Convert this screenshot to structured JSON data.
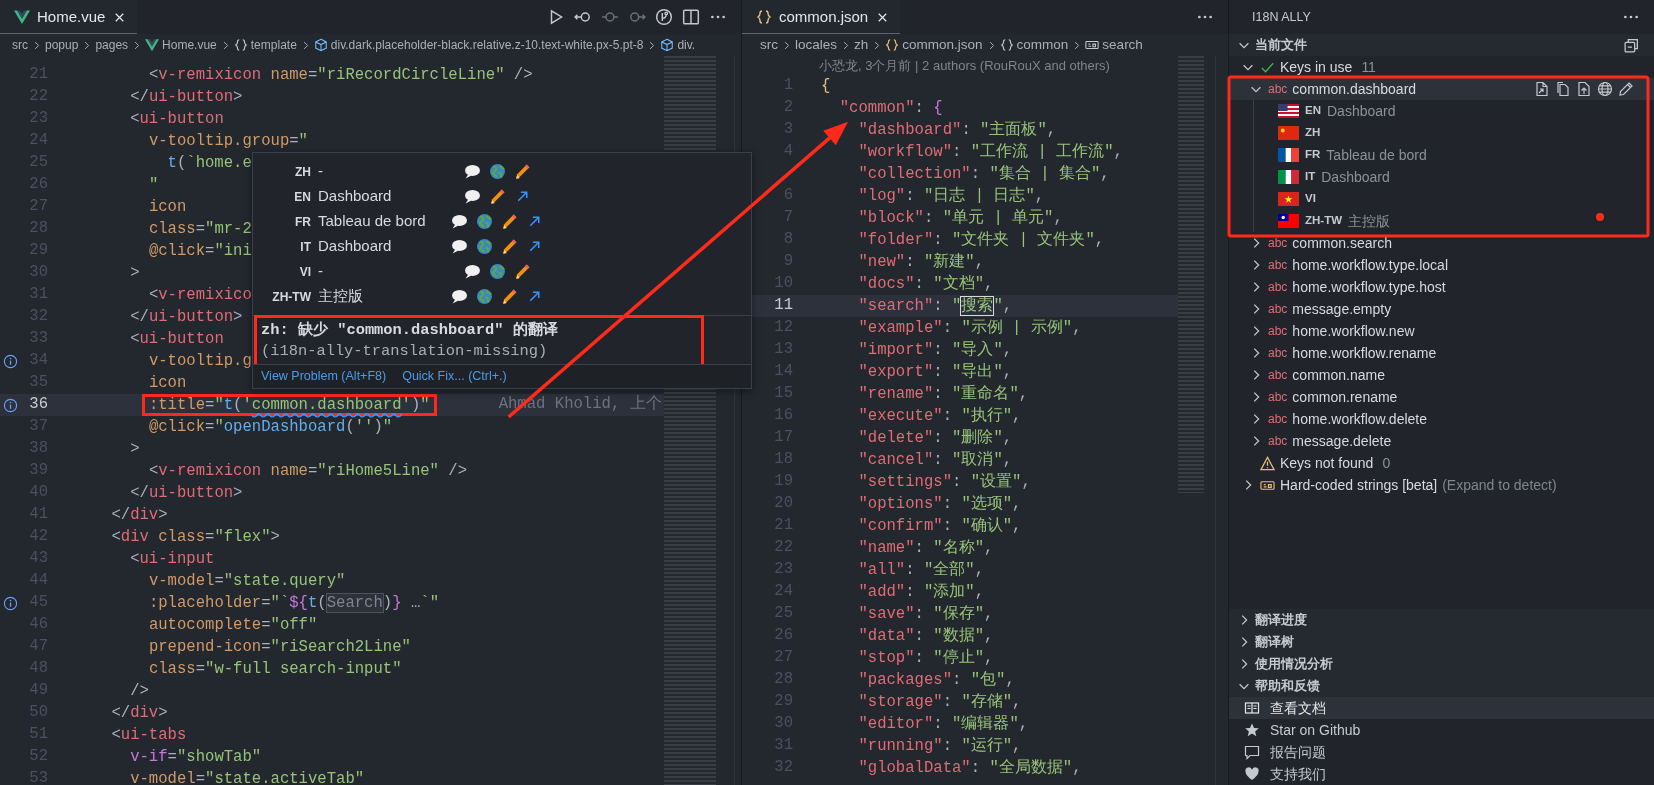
{
  "editors": [
    {
      "tabs": [
        {
          "label": "Home.vue",
          "kind": "vue",
          "selected": true
        }
      ],
      "toolbar": [
        {
          "kind": "play"
        },
        {
          "kind": "back-circle"
        },
        {
          "kind": "commit"
        },
        {
          "kind": "forward-circle"
        },
        {
          "kind": "branch-circle"
        },
        {
          "kind": "split"
        },
        {
          "kind": "more"
        }
      ],
      "breadcrumb": [
        {
          "label": "src"
        },
        {
          "label": "popup"
        },
        {
          "label": "pages"
        },
        {
          "label": "Home.vue",
          "kind": "vue"
        },
        {
          "label": "template",
          "kind": "braces"
        },
        {
          "label": "div.dark.placeholder-black.relative.z-10.text-white.px-5.pt-8",
          "kind": "cube"
        },
        {
          "label": "div.",
          "kind": "cube"
        }
      ],
      "lines": [
        {
          "n": "21",
          "current": false,
          "info": false,
          "tokens": [
            {
              "kind": "p",
              "text": "        <"
            },
            {
              "kind": "t",
              "text": "v-remixicon"
            },
            {
              "kind": "a",
              "text": " name"
            },
            {
              "kind": "p",
              "text": "="
            },
            {
              "kind": "s",
              "text": "\"riRecordCircleLine\""
            },
            {
              "kind": "p",
              "text": " />"
            }
          ]
        },
        {
          "n": "22",
          "current": false,
          "info": false,
          "tokens": [
            {
              "kind": "p",
              "text": "      </"
            },
            {
              "kind": "t",
              "text": "ui-button"
            },
            {
              "kind": "p",
              "text": ">"
            }
          ]
        },
        {
          "n": "23",
          "current": false,
          "info": false,
          "tokens": [
            {
              "kind": "p",
              "text": "      <"
            },
            {
              "kind": "t",
              "text": "ui-button"
            }
          ]
        },
        {
          "n": "24",
          "current": false,
          "info": false,
          "tokens": [
            {
              "kind": "a",
              "text": "        v-tooltip.group"
            },
            {
              "kind": "p",
              "text": "="
            },
            {
              "kind": "s",
              "text": "\""
            }
          ]
        },
        {
          "n": "25",
          "current": false,
          "info": false,
          "tokens": [
            {
              "kind": "f",
              "text": "          t"
            },
            {
              "kind": "p",
              "text": "("
            },
            {
              "kind": "s",
              "text": "`home.e"
            }
          ]
        },
        {
          "n": "26",
          "current": false,
          "info": false,
          "tokens": [
            {
              "kind": "s",
              "text": "        \""
            }
          ]
        },
        {
          "n": "27",
          "current": false,
          "info": false,
          "tokens": [
            {
              "kind": "a",
              "text": "        icon"
            }
          ]
        },
        {
          "n": "28",
          "current": false,
          "info": false,
          "tokens": [
            {
              "kind": "a",
              "text": "        class"
            },
            {
              "kind": "p",
              "text": "="
            },
            {
              "kind": "s",
              "text": "\"mr-2"
            }
          ]
        },
        {
          "n": "29",
          "current": false,
          "info": false,
          "tokens": [
            {
              "kind": "a",
              "text": "        @click"
            },
            {
              "kind": "p",
              "text": "="
            },
            {
              "kind": "s",
              "text": "\"ini"
            }
          ]
        },
        {
          "n": "30",
          "current": false,
          "info": false,
          "tokens": [
            {
              "kind": "p",
              "text": "      >"
            }
          ]
        },
        {
          "n": "31",
          "current": false,
          "info": false,
          "tokens": [
            {
              "kind": "p",
              "text": "        <"
            },
            {
              "kind": "t",
              "text": "v-remixico"
            }
          ]
        },
        {
          "n": "32",
          "current": false,
          "info": false,
          "tokens": [
            {
              "kind": "p",
              "text": "      </"
            },
            {
              "kind": "t",
              "text": "ui-button"
            },
            {
              "kind": "p",
              "text": ">"
            }
          ]
        },
        {
          "n": "33",
          "current": false,
          "info": false,
          "tokens": [
            {
              "kind": "p",
              "text": "      <"
            },
            {
              "kind": "t",
              "text": "ui-button"
            }
          ]
        },
        {
          "n": "34",
          "current": false,
          "info": true,
          "tokens": [
            {
              "kind": "a",
              "text": "        v-tooltip.g"
            }
          ]
        },
        {
          "n": "35",
          "current": false,
          "info": false,
          "tokens": [
            {
              "kind": "a",
              "text": "        icon"
            }
          ]
        },
        {
          "n": "36",
          "current": true,
          "info": true,
          "blame": "Ahmad Kholid, 上个",
          "tokens": [
            {
              "kind": "a",
              "text": "        :title"
            },
            {
              "kind": "p",
              "text": "="
            },
            {
              "kind": "s",
              "text": "\""
            },
            {
              "kind": "f",
              "text": "t"
            },
            {
              "kind": "p",
              "text": "("
            },
            {
              "kind": "s",
              "text": "'"
            },
            {
              "kind": "w",
              "text": "common.dashboard"
            },
            {
              "kind": "s",
              "text": "'"
            },
            {
              "kind": "p",
              "text": ")"
            },
            {
              "kind": "s",
              "text": "\""
            }
          ]
        },
        {
          "n": "37",
          "current": false,
          "info": false,
          "tokens": [
            {
              "kind": "a",
              "text": "        @click"
            },
            {
              "kind": "p",
              "text": "="
            },
            {
              "kind": "s",
              "text": "\""
            },
            {
              "kind": "f",
              "text": "openDashboard"
            },
            {
              "kind": "p",
              "text": "("
            },
            {
              "kind": "s",
              "text": "''"
            },
            {
              "kind": "p",
              "text": ")"
            },
            {
              "kind": "s",
              "text": "\""
            }
          ]
        },
        {
          "n": "38",
          "current": false,
          "info": false,
          "tokens": [
            {
              "kind": "p",
              "text": "      >"
            }
          ]
        },
        {
          "n": "39",
          "current": false,
          "info": false,
          "tokens": [
            {
              "kind": "p",
              "text": "        <"
            },
            {
              "kind": "t",
              "text": "v-remixicon"
            },
            {
              "kind": "a",
              "text": " name"
            },
            {
              "kind": "p",
              "text": "="
            },
            {
              "kind": "s",
              "text": "\"riHome5Line\""
            },
            {
              "kind": "p",
              "text": " />"
            }
          ]
        },
        {
          "n": "40",
          "current": false,
          "info": false,
          "tokens": [
            {
              "kind": "p",
              "text": "      </"
            },
            {
              "kind": "t",
              "text": "ui-button"
            },
            {
              "kind": "p",
              "text": ">"
            }
          ]
        },
        {
          "n": "41",
          "current": false,
          "info": false,
          "tokens": [
            {
              "kind": "p",
              "text": "    </"
            },
            {
              "kind": "t",
              "text": "div"
            },
            {
              "kind": "p",
              "text": ">"
            }
          ]
        },
        {
          "n": "42",
          "current": false,
          "info": false,
          "tokens": [
            {
              "kind": "p",
              "text": "    <"
            },
            {
              "kind": "t",
              "text": "div"
            },
            {
              "kind": "a",
              "text": " class"
            },
            {
              "kind": "p",
              "text": "="
            },
            {
              "kind": "s",
              "text": "\"flex\""
            },
            {
              "kind": "p",
              "text": ">"
            }
          ]
        },
        {
          "n": "43",
          "current": false,
          "info": false,
          "tokens": [
            {
              "kind": "p",
              "text": "      <"
            },
            {
              "kind": "t",
              "text": "ui-input"
            }
          ]
        },
        {
          "n": "44",
          "current": false,
          "info": false,
          "tokens": [
            {
              "kind": "a",
              "text": "        v-model"
            },
            {
              "kind": "p",
              "text": "="
            },
            {
              "kind": "s",
              "text": "\"state.query\""
            }
          ]
        },
        {
          "n": "45",
          "current": false,
          "info": true,
          "tokens": [
            {
              "kind": "a",
              "text": "        :placeholder"
            },
            {
              "kind": "p",
              "text": "="
            },
            {
              "kind": "s",
              "text": "\"`"
            },
            {
              "kind": "k",
              "text": "${"
            },
            {
              "kind": "f",
              "text": "t"
            },
            {
              "kind": "p",
              "text": "("
            },
            {
              "kind": "h",
              "text": "Search"
            },
            {
              "kind": "p",
              "text": ")"
            },
            {
              "kind": "k",
              "text": "}"
            },
            {
              "kind": "p",
              "text": " …"
            },
            {
              "kind": "s",
              "text": "`\""
            }
          ]
        },
        {
          "n": "46",
          "current": false,
          "info": false,
          "tokens": [
            {
              "kind": "a",
              "text": "        autocomplete"
            },
            {
              "kind": "p",
              "text": "="
            },
            {
              "kind": "s",
              "text": "\"off\""
            }
          ]
        },
        {
          "n": "47",
          "current": false,
          "info": false,
          "tokens": [
            {
              "kind": "a",
              "text": "        prepend-icon"
            },
            {
              "kind": "p",
              "text": "="
            },
            {
              "kind": "s",
              "text": "\"riSearch2Line\""
            }
          ]
        },
        {
          "n": "48",
          "current": false,
          "info": false,
          "tokens": [
            {
              "kind": "a",
              "text": "        class"
            },
            {
              "kind": "p",
              "text": "="
            },
            {
              "kind": "s",
              "text": "\"w-full search-input\""
            }
          ]
        },
        {
          "n": "49",
          "current": false,
          "info": false,
          "tokens": [
            {
              "kind": "p",
              "text": "      />"
            }
          ]
        },
        {
          "n": "50",
          "current": false,
          "info": false,
          "tokens": [
            {
              "kind": "p",
              "text": "    </"
            },
            {
              "kind": "t",
              "text": "div"
            },
            {
              "kind": "p",
              "text": ">"
            }
          ]
        },
        {
          "n": "51",
          "current": false,
          "info": false,
          "tokens": [
            {
              "kind": "p",
              "text": "    <"
            },
            {
              "kind": "t",
              "text": "ui-tabs"
            }
          ]
        },
        {
          "n": "52",
          "current": false,
          "info": false,
          "tokens": [
            {
              "kind": "k",
              "text": "      v-if"
            },
            {
              "kind": "p",
              "text": "="
            },
            {
              "kind": "s",
              "text": "\"showTab\""
            }
          ]
        },
        {
          "n": "53",
          "current": false,
          "info": false,
          "tokens": [
            {
              "kind": "a",
              "text": "      v-model"
            },
            {
              "kind": "p",
              "text": "="
            },
            {
              "kind": "s",
              "text": "\"state.activeTab\""
            }
          ]
        }
      ],
      "hover": {
        "rows": [
          {
            "code": "ZH",
            "value": "-",
            "actions": [
              {
                "kind": "comment"
              },
              {
                "kind": "globe"
              },
              {
                "kind": "edit"
              }
            ]
          },
          {
            "code": "EN",
            "value": "Dashboard",
            "actions": [
              {
                "kind": "comment"
              },
              {
                "kind": "edit"
              },
              {
                "kind": "open"
              }
            ]
          },
          {
            "code": "FR",
            "value": "Tableau de bord",
            "actions": [
              {
                "kind": "comment"
              },
              {
                "kind": "globe"
              },
              {
                "kind": "edit"
              },
              {
                "kind": "open"
              }
            ]
          },
          {
            "code": "IT",
            "value": "Dashboard",
            "actions": [
              {
                "kind": "comment"
              },
              {
                "kind": "globe"
              },
              {
                "kind": "edit"
              },
              {
                "kind": "open"
              }
            ]
          },
          {
            "code": "VI",
            "value": "-",
            "actions": [
              {
                "kind": "comment"
              },
              {
                "kind": "globe"
              },
              {
                "kind": "edit"
              }
            ]
          },
          {
            "code": "ZH-TW",
            "value": "主控版",
            "actions": [
              {
                "kind": "comment"
              },
              {
                "kind": "globe"
              },
              {
                "kind": "edit"
              },
              {
                "kind": "open"
              }
            ]
          }
        ],
        "message": "zh: 缺少 \"common.dashboard\" 的翻译",
        "source": "(i18n-ally-translation-missing)",
        "links": [
          "View Problem (Alt+F8)",
          "Quick Fix... (Ctrl+.)"
        ]
      }
    },
    {
      "tabs": [
        {
          "label": "common.json",
          "kind": "json",
          "selected": true
        }
      ],
      "toolbar": [
        {
          "kind": "more"
        }
      ],
      "breadcrumb": [
        {
          "label": "src"
        },
        {
          "label": "locales"
        },
        {
          "label": "zh"
        },
        {
          "label": "common.json",
          "kind": "json"
        },
        {
          "label": "common",
          "kind": "braces"
        },
        {
          "label": "search",
          "kind": "string-box"
        }
      ],
      "codelens": "小恐龙, 3个月前 | 2 authors (RouRouX and others)",
      "lines": [
        {
          "n": "1",
          "current": false,
          "tokens": [
            {
              "kind": "y",
              "text": "{"
            }
          ]
        },
        {
          "n": "2",
          "current": false,
          "tokens": [
            {
              "kind": "j",
              "text": "  \"common\""
            },
            {
              "kind": "p",
              "text": ": "
            },
            {
              "kind": "v",
              "text": "{"
            }
          ]
        },
        {
          "n": "3",
          "current": false,
          "tokens": [
            {
              "kind": "j",
              "text": "    \"dashboard\""
            },
            {
              "kind": "p",
              "text": ": "
            },
            {
              "kind": "s",
              "text": "\"主面板\""
            },
            {
              "kind": "p",
              "text": ","
            }
          ]
        },
        {
          "n": "4",
          "current": false,
          "tokens": [
            {
              "kind": "j",
              "text": "    \"workflow\""
            },
            {
              "kind": "p",
              "text": ": "
            },
            {
              "kind": "s",
              "text": "\"工作流 | 工作流\""
            },
            {
              "kind": "p",
              "text": ","
            }
          ]
        },
        {
          "current": false,
          "tokens": [
            {
              "kind": "j",
              "text": "    \"collection\""
            },
            {
              "kind": "p",
              "text": ": "
            },
            {
              "kind": "s",
              "text": "\"集合 | 集合\""
            },
            {
              "kind": "p",
              "text": ","
            }
          ]
        },
        {
          "n": "6",
          "current": false,
          "tokens": [
            {
              "kind": "j",
              "text": "    \"log\""
            },
            {
              "kind": "p",
              "text": ": "
            },
            {
              "kind": "s",
              "text": "\"日志 | 日志\""
            },
            {
              "kind": "p",
              "text": ","
            }
          ]
        },
        {
          "n": "7",
          "current": false,
          "tokens": [
            {
              "kind": "j",
              "text": "    \"block\""
            },
            {
              "kind": "p",
              "text": ": "
            },
            {
              "kind": "s",
              "text": "\"单元 | 单元\""
            },
            {
              "kind": "p",
              "text": ","
            }
          ]
        },
        {
          "n": "8",
          "current": false,
          "tokens": [
            {
              "kind": "j",
              "text": "    \"folder\""
            },
            {
              "kind": "p",
              "text": ": "
            },
            {
              "kind": "s",
              "text": "\"文件夹 | 文件夹\""
            },
            {
              "kind": "p",
              "text": ","
            }
          ]
        },
        {
          "n": "9",
          "current": false,
          "tokens": [
            {
              "kind": "j",
              "text": "    \"new\""
            },
            {
              "kind": "p",
              "text": ": "
            },
            {
              "kind": "s",
              "text": "\"新建\""
            },
            {
              "kind": "p",
              "text": ","
            }
          ]
        },
        {
          "n": "10",
          "current": false,
          "tokens": [
            {
              "kind": "j",
              "text": "    \"docs\""
            },
            {
              "kind": "p",
              "text": ": "
            },
            {
              "kind": "s",
              "text": "\"文档\""
            },
            {
              "kind": "p",
              "text": ","
            }
          ]
        },
        {
          "n": "11",
          "current": true,
          "tokens": [
            {
              "kind": "j",
              "text": "    \"search\""
            },
            {
              "kind": "p",
              "text": ": "
            },
            {
              "kind": "s",
              "text": "\""
            },
            {
              "kind": "x",
              "text": "搜索"
            },
            {
              "kind": "s",
              "text": "\""
            },
            {
              "kind": "p",
              "text": ","
            }
          ]
        },
        {
          "n": "12",
          "current": false,
          "tokens": [
            {
              "kind": "j",
              "text": "    \"example\""
            },
            {
              "kind": "p",
              "text": ": "
            },
            {
              "kind": "s",
              "text": "\"示例 | 示例\""
            },
            {
              "kind": "p",
              "text": ","
            }
          ]
        },
        {
          "n": "13",
          "current": false,
          "tokens": [
            {
              "kind": "j",
              "text": "    \"import\""
            },
            {
              "kind": "p",
              "text": ": "
            },
            {
              "kind": "s",
              "text": "\"导入\""
            },
            {
              "kind": "p",
              "text": ","
            }
          ]
        },
        {
          "n": "14",
          "current": false,
          "tokens": [
            {
              "kind": "j",
              "text": "    \"export\""
            },
            {
              "kind": "p",
              "text": ": "
            },
            {
              "kind": "s",
              "text": "\"导出\""
            },
            {
              "kind": "p",
              "text": ","
            }
          ]
        },
        {
          "n": "15",
          "current": false,
          "tokens": [
            {
              "kind": "j",
              "text": "    \"rename\""
            },
            {
              "kind": "p",
              "text": ": "
            },
            {
              "kind": "s",
              "text": "\"重命名\""
            },
            {
              "kind": "p",
              "text": ","
            }
          ]
        },
        {
          "n": "16",
          "current": false,
          "tokens": [
            {
              "kind": "j",
              "text": "    \"execute\""
            },
            {
              "kind": "p",
              "text": ": "
            },
            {
              "kind": "s",
              "text": "\"执行\""
            },
            {
              "kind": "p",
              "text": ","
            }
          ]
        },
        {
          "n": "17",
          "current": false,
          "tokens": [
            {
              "kind": "j",
              "text": "    \"delete\""
            },
            {
              "kind": "p",
              "text": ": "
            },
            {
              "kind": "s",
              "text": "\"删除\""
            },
            {
              "kind": "p",
              "text": ","
            }
          ]
        },
        {
          "n": "18",
          "current": false,
          "tokens": [
            {
              "kind": "j",
              "text": "    \"cancel\""
            },
            {
              "kind": "p",
              "text": ": "
            },
            {
              "kind": "s",
              "text": "\"取消\""
            },
            {
              "kind": "p",
              "text": ","
            }
          ]
        },
        {
          "n": "19",
          "current": false,
          "tokens": [
            {
              "kind": "j",
              "text": "    \"settings\""
            },
            {
              "kind": "p",
              "text": ": "
            },
            {
              "kind": "s",
              "text": "\"设置\""
            },
            {
              "kind": "p",
              "text": ","
            }
          ]
        },
        {
          "n": "20",
          "current": false,
          "tokens": [
            {
              "kind": "j",
              "text": "    \"options\""
            },
            {
              "kind": "p",
              "text": ": "
            },
            {
              "kind": "s",
              "text": "\"选项\""
            },
            {
              "kind": "p",
              "text": ","
            }
          ]
        },
        {
          "n": "21",
          "current": false,
          "tokens": [
            {
              "kind": "j",
              "text": "    \"confirm\""
            },
            {
              "kind": "p",
              "text": ": "
            },
            {
              "kind": "s",
              "text": "\"确认\""
            },
            {
              "kind": "p",
              "text": ","
            }
          ]
        },
        {
          "n": "22",
          "current": false,
          "tokens": [
            {
              "kind": "j",
              "text": "    \"name\""
            },
            {
              "kind": "p",
              "text": ": "
            },
            {
              "kind": "s",
              "text": "\"名称\""
            },
            {
              "kind": "p",
              "text": ","
            }
          ]
        },
        {
          "n": "23",
          "current": false,
          "tokens": [
            {
              "kind": "j",
              "text": "    \"all\""
            },
            {
              "kind": "p",
              "text": ": "
            },
            {
              "kind": "s",
              "text": "\"全部\""
            },
            {
              "kind": "p",
              "text": ","
            }
          ]
        },
        {
          "n": "24",
          "current": false,
          "tokens": [
            {
              "kind": "j",
              "text": "    \"add\""
            },
            {
              "kind": "p",
              "text": ": "
            },
            {
              "kind": "s",
              "text": "\"添加\""
            },
            {
              "kind": "p",
              "text": ","
            }
          ]
        },
        {
          "n": "25",
          "current": false,
          "tokens": [
            {
              "kind": "j",
              "text": "    \"save\""
            },
            {
              "kind": "p",
              "text": ": "
            },
            {
              "kind": "s",
              "text": "\"保存\""
            },
            {
              "kind": "p",
              "text": ","
            }
          ]
        },
        {
          "n": "26",
          "current": false,
          "tokens": [
            {
              "kind": "j",
              "text": "    \"data\""
            },
            {
              "kind": "p",
              "text": ": "
            },
            {
              "kind": "s",
              "text": "\"数据\""
            },
            {
              "kind": "p",
              "text": ","
            }
          ]
        },
        {
          "n": "27",
          "current": false,
          "tokens": [
            {
              "kind": "j",
              "text": "    \"stop\""
            },
            {
              "kind": "p",
              "text": ": "
            },
            {
              "kind": "s",
              "text": "\"停止\""
            },
            {
              "kind": "p",
              "text": ","
            }
          ]
        },
        {
          "n": "28",
          "current": false,
          "tokens": [
            {
              "kind": "j",
              "text": "    \"packages\""
            },
            {
              "kind": "p",
              "text": ": "
            },
            {
              "kind": "s",
              "text": "\"包\""
            },
            {
              "kind": "p",
              "text": ","
            }
          ]
        },
        {
          "n": "29",
          "current": false,
          "tokens": [
            {
              "kind": "j",
              "text": "    \"storage\""
            },
            {
              "kind": "p",
              "text": ": "
            },
            {
              "kind": "s",
              "text": "\"存储\""
            },
            {
              "kind": "p",
              "text": ","
            }
          ]
        },
        {
          "n": "30",
          "current": false,
          "tokens": [
            {
              "kind": "j",
              "text": "    \"editor\""
            },
            {
              "kind": "p",
              "text": ": "
            },
            {
              "kind": "s",
              "text": "\"编辑器\""
            },
            {
              "kind": "p",
              "text": ","
            }
          ]
        },
        {
          "n": "31",
          "current": false,
          "tokens": [
            {
              "kind": "j",
              "text": "    \"running\""
            },
            {
              "kind": "p",
              "text": ": "
            },
            {
              "kind": "s",
              "text": "\"运行\""
            },
            {
              "kind": "p",
              "text": ","
            }
          ]
        },
        {
          "n": "32",
          "current": false,
          "tokens": [
            {
              "kind": "j",
              "text": "    \"globalData\""
            },
            {
              "kind": "p",
              "text": ": "
            },
            {
              "kind": "s",
              "text": "\"全局数据\""
            },
            {
              "kind": "p",
              "text": ","
            }
          ]
        }
      ]
    }
  ],
  "sidebar": {
    "title": "I18N ALLY",
    "sections": [
      {
        "title": "当前文件",
        "expanded": true,
        "actions": [
          {
            "kind": "collapse-all"
          }
        ],
        "tree": [
          {
            "label": "Keys in use",
            "count": "11",
            "kind": "check",
            "expanded": true,
            "children": [
              {
                "label": "common.dashboard",
                "tag": "abc",
                "expanded": true,
                "selected": true,
                "actions": [
                  {
                    "kind": "doc-arrow"
                  },
                  {
                    "kind": "docs"
                  },
                  {
                    "kind": "doc-upload"
                  },
                  {
                    "kind": "globe-line"
                  },
                  {
                    "kind": "pencil"
                  }
                ],
                "locales": [
                  {
                    "code": "EN",
                    "kind": "us",
                    "value": "Dashboard"
                  },
                  {
                    "code": "ZH",
                    "kind": "cn"
                  },
                  {
                    "code": "FR",
                    "kind": "fr",
                    "value": "Tableau de bord"
                  },
                  {
                    "code": "IT",
                    "kind": "it",
                    "value": "Dashboard"
                  },
                  {
                    "code": "VI",
                    "kind": "vn"
                  },
                  {
                    "code": "ZH-TW",
                    "kind": "tw",
                    "value": "主控版"
                  }
                ]
              },
              {
                "label": "common.search",
                "tag": "abc",
                "expanded": false,
                "selected": false
              },
              {
                "label": "home.workflow.type.local",
                "tag": "abc",
                "expanded": false,
                "selected": false
              },
              {
                "label": "home.workflow.type.host",
                "tag": "abc",
                "expanded": false,
                "selected": false
              },
              {
                "label": "message.empty",
                "tag": "abc",
                "expanded": false,
                "selected": false
              },
              {
                "label": "home.workflow.new",
                "tag": "abc",
                "expanded": false,
                "selected": false
              },
              {
                "label": "home.workflow.rename",
                "tag": "abc",
                "expanded": false,
                "selected": false
              },
              {
                "label": "common.name",
                "tag": "abc",
                "expanded": false,
                "selected": false
              },
              {
                "label": "common.rename",
                "tag": "abc",
                "expanded": false,
                "selected": false
              },
              {
                "label": "home.workflow.delete",
                "tag": "abc",
                "expanded": false,
                "selected": false
              },
              {
                "label": "message.delete",
                "tag": "abc",
                "expanded": false,
                "selected": false
              }
            ]
          },
          {
            "label": "Keys not found",
            "count": "0",
            "kind": "warning"
          },
          {
            "label": "Hard-coded strings [beta]",
            "note": "(Expand to detect)",
            "kind": "string-yellow",
            "expanded": false
          }
        ]
      },
      {
        "title": "翻译进度",
        "expanded": false
      },
      {
        "title": "翻译树",
        "expanded": false
      },
      {
        "title": "使用情况分析",
        "expanded": false
      },
      {
        "title": "帮助和反馈",
        "expanded": true,
        "items": [
          {
            "label": "查看文档",
            "kind": "book",
            "selected": true
          },
          {
            "label": "Star on Github",
            "kind": "star",
            "selected": false
          },
          {
            "label": "报告问题",
            "kind": "comment-line",
            "selected": false
          },
          {
            "label": "支持我们",
            "kind": "heart",
            "selected": false
          }
        ]
      }
    ]
  },
  "annotations": [
    {
      "kind": "box"
    },
    {
      "kind": "box"
    },
    {
      "kind": "box"
    },
    {
      "kind": "arrow"
    },
    {
      "kind": "dot"
    }
  ]
}
